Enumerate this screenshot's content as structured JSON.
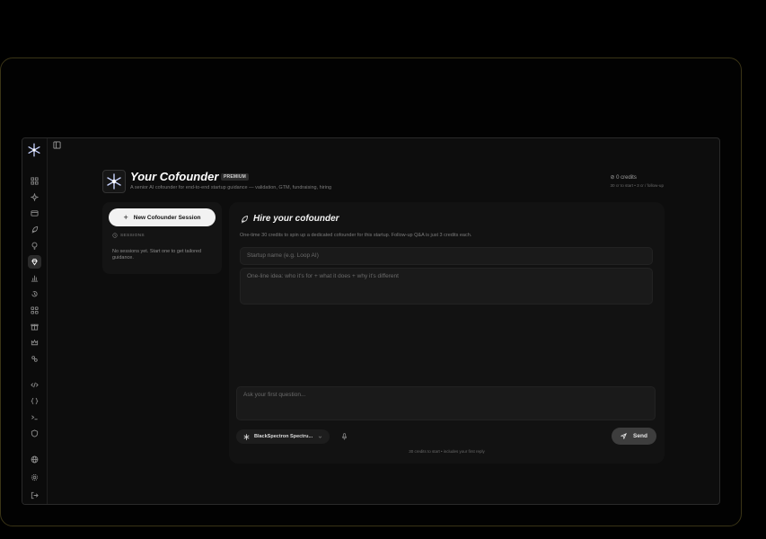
{
  "header": {
    "title": "Your Cofounder",
    "badge": "PREMIUM",
    "subtitle": "A senior AI cofounder for end-to-end startup guidance — validation, GTM, fundraising, hiring",
    "credits": "0 credits",
    "credits_note": "30 cr to start • 3 cr / follow-up"
  },
  "sessions": {
    "new_button": "New Cofounder Session",
    "label": "SESSIONS",
    "empty_text": "No sessions yet. Start one to get tailored guidance."
  },
  "main": {
    "title": "Hire your cofounder",
    "description": "One-time 30 credits to spin up a dedicated cofounder for this startup. Follow-up Q&A is just 3 credits each.",
    "startup_placeholder": "Startup name (e.g. Loop AI)",
    "idea_placeholder": "One-line idea: who it's for + what it does + why it's different",
    "question_placeholder": "Ask your first question...",
    "model": "BlackSpectron Spectru...",
    "send_label": "Send",
    "footer": "30 credits to start • includes your first reply"
  },
  "sidebar": {
    "items": [
      "grid-icon",
      "sparkle-icon",
      "card-icon",
      "rocket-icon",
      "bulb-icon",
      "gem-icon",
      "chart-icon",
      "history-icon",
      "apps-icon",
      "gift-icon",
      "crown-icon",
      "users-icon",
      "code-icon",
      "braces-icon",
      "terminal-icon",
      "shield-icon",
      "globe-icon",
      "settings-icon",
      "logout-icon"
    ],
    "active": "gem-icon"
  },
  "colors": {
    "accent": "#f2f2f2",
    "frame": "#3a3416",
    "background": "#000000"
  }
}
